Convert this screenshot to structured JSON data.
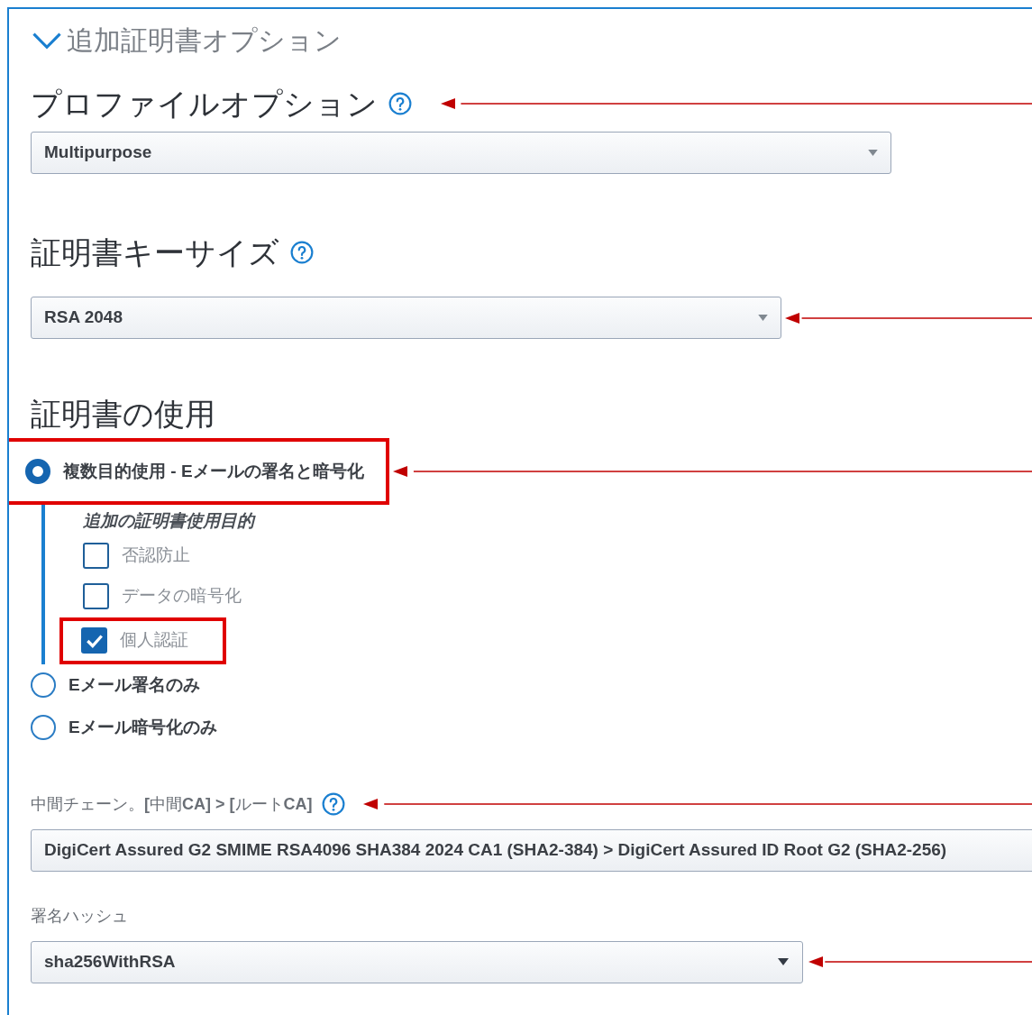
{
  "section": {
    "title": "追加証明書オプション",
    "expanded": true
  },
  "profile": {
    "heading": "プロファイルオプション",
    "help": true,
    "value": "Multipurpose",
    "arrow": true
  },
  "key_size": {
    "heading": "証明書キーサイズ",
    "help": true,
    "value": "RSA 2048",
    "arrow": true
  },
  "usage": {
    "heading": "証明書の使用",
    "options": [
      {
        "label": "複数目的使用 - Eメールの署名と暗号化",
        "selected": true,
        "highlighted": true,
        "arrow": true,
        "sub_heading": "追加の証明書使用目的",
        "checkboxes": [
          {
            "label": "否認防止",
            "checked": false,
            "highlighted": false
          },
          {
            "label": "データの暗号化",
            "checked": false,
            "highlighted": false
          },
          {
            "label": "個人認証",
            "checked": true,
            "highlighted": true
          }
        ]
      },
      {
        "label": "Eメール署名のみ",
        "selected": false,
        "highlighted": false,
        "arrow": false
      },
      {
        "label": "Eメール暗号化のみ",
        "selected": false,
        "highlighted": false,
        "arrow": false
      }
    ]
  },
  "chain": {
    "label": "中間チェーン。**[**中間**CA] > [**ルート**CA]**",
    "help": true,
    "value": "DigiCert Assured G2 SMIME RSA4096 SHA384 2024 CA1 (SHA2-384) > DigiCert Assured ID Root G2 (SHA2-256)",
    "arrow": true
  },
  "hash": {
    "label": "署名ハッシュ",
    "value": "sha256WithRSA",
    "arrow": true
  }
}
